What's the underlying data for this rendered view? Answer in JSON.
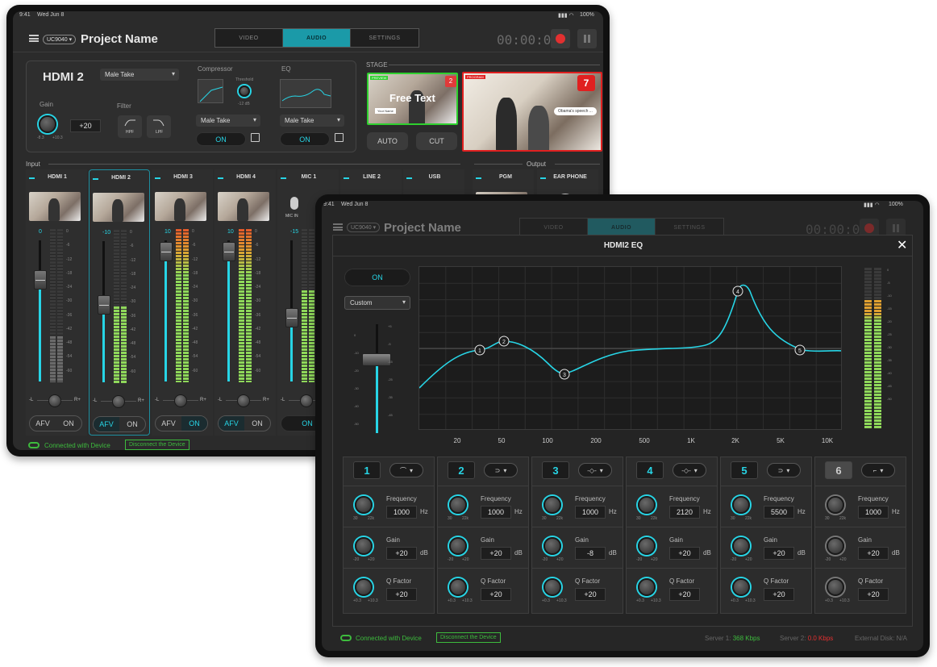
{
  "status_back": {
    "left": "9:41",
    "date": "Wed Jun 8",
    "battery": "100%"
  },
  "status_front": {
    "time": "9:41",
    "date": "Wed Jun 8",
    "battery": "100%"
  },
  "header": {
    "model": "UC9040 ▾",
    "project_name": "Project Name",
    "tabs": [
      "VIDEO",
      "AUDIO",
      "SETTINGS"
    ],
    "active_tab": "AUDIO",
    "timer": "00:00:00"
  },
  "control_panel": {
    "source": "HDMI 2",
    "source_preset": "Male Take",
    "gain_label": "Gain",
    "gain_min": "-8.3",
    "gain_max": "+10.3",
    "gain_value": "+20",
    "filter_label": "Filter",
    "hpf": "HPF",
    "lpf": "LPF",
    "compressor_label": "Compressor",
    "threshold_label": "Threshold",
    "threshold_value": "-12 dB",
    "compressor_preset": "Male Take",
    "compressor_on": "ON",
    "eq_label": "EQ",
    "eq_preset": "Male Take",
    "eq_on": "ON"
  },
  "stage": {
    "label": "STAGE",
    "preview_tag": "PREVIEW",
    "preview_number": "2",
    "preview_text": "Free Text",
    "preview_name": "Your Name",
    "program_tag": "PROGRAM",
    "program_number": "7",
    "program_caption": "Obama's speech ...",
    "auto": "AUTO",
    "cut": "CUT"
  },
  "mixer": {
    "input_label": "Input",
    "output_label": "Output",
    "channels": [
      {
        "name": "HDMI 1",
        "level": "0",
        "fader": 0.72
      },
      {
        "name": "HDMI 2",
        "level": "-10",
        "fader": 0.55
      },
      {
        "name": "HDMI 3",
        "level": "10",
        "fader": 0.92
      },
      {
        "name": "HDMI 4",
        "level": "10",
        "fader": 0.92
      },
      {
        "name": "MIC 1",
        "level": "-15",
        "fader": 0.45
      },
      {
        "name": "LINE 2",
        "level": "",
        "fader": 0
      },
      {
        "name": "USB",
        "level": "",
        "fader": 0
      }
    ],
    "outputs": [
      {
        "name": "PGM"
      },
      {
        "name": "EAR PHONE"
      }
    ],
    "mic_in": "MIC IN",
    "scale": [
      "0",
      "-6",
      "-12",
      "-18",
      "-24",
      "-30",
      "-36",
      "-42",
      "-48",
      "-54",
      "-60"
    ],
    "pan_left": "-L",
    "pan_right": "R+",
    "afv": "AFV",
    "on": "ON"
  },
  "footer_back": {
    "connected": "Connected with Device",
    "disconnect": "Disconnect the Device"
  },
  "eq_modal": {
    "title": "HDMI2 EQ",
    "on": "ON",
    "preset": "Custom",
    "fader_scale": [
      "+5",
      "0",
      "-5",
      "-10",
      "-15",
      "-20",
      "-25",
      "-30",
      "-35",
      "-40",
      "-45",
      "-50"
    ],
    "meter_scale": [
      "0",
      "-5",
      "-10",
      "-15",
      "-20",
      "-25",
      "-30",
      "-35",
      "-40",
      "-45",
      "-50"
    ],
    "freq_labels": [
      "20",
      "50",
      "100",
      "200",
      "500",
      "1K",
      "2K",
      "5K",
      "10K"
    ],
    "bands": [
      {
        "num": "1",
        "type": "high-shelf",
        "freq": "1000",
        "gain": "+20",
        "q": "+20",
        "active": true
      },
      {
        "num": "2",
        "type": "low-shelf",
        "freq": "1000",
        "gain": "+20",
        "q": "+20",
        "active": true
      },
      {
        "num": "3",
        "type": "peak",
        "freq": "1000",
        "gain": "-8",
        "q": "+20",
        "active": true
      },
      {
        "num": "4",
        "type": "peak",
        "freq": "2120",
        "gain": "+20",
        "q": "+20",
        "active": true
      },
      {
        "num": "5",
        "type": "low-shelf",
        "freq": "5500",
        "gain": "+20",
        "q": "+20",
        "active": true
      },
      {
        "num": "6",
        "type": "low-pass",
        "freq": "1000",
        "gain": "+20",
        "q": "+20",
        "active": false
      }
    ],
    "frequency_label": "Frequency",
    "gain_label": "Gain",
    "q_label": "Q Factor",
    "hz": "Hz",
    "db": "dB",
    "freq_min": "30",
    "freq_max": "22k",
    "gain_min": "-20",
    "gain_max": "+20",
    "q_min": "+0.3",
    "q_max": "+10.3"
  },
  "footer_front": {
    "connected": "Connected with Device",
    "disconnect": "Disconnect the Device",
    "server1_label": "Server 1:",
    "server1_value": "368 Kbps",
    "server2_label": "Server 2:",
    "server2_value": "0.0 Kbps",
    "disk_label": "External Disk: N/A"
  },
  "colors": {
    "accent": "#27d5e6",
    "record": "#e23030",
    "connected": "#3dbb3d"
  }
}
